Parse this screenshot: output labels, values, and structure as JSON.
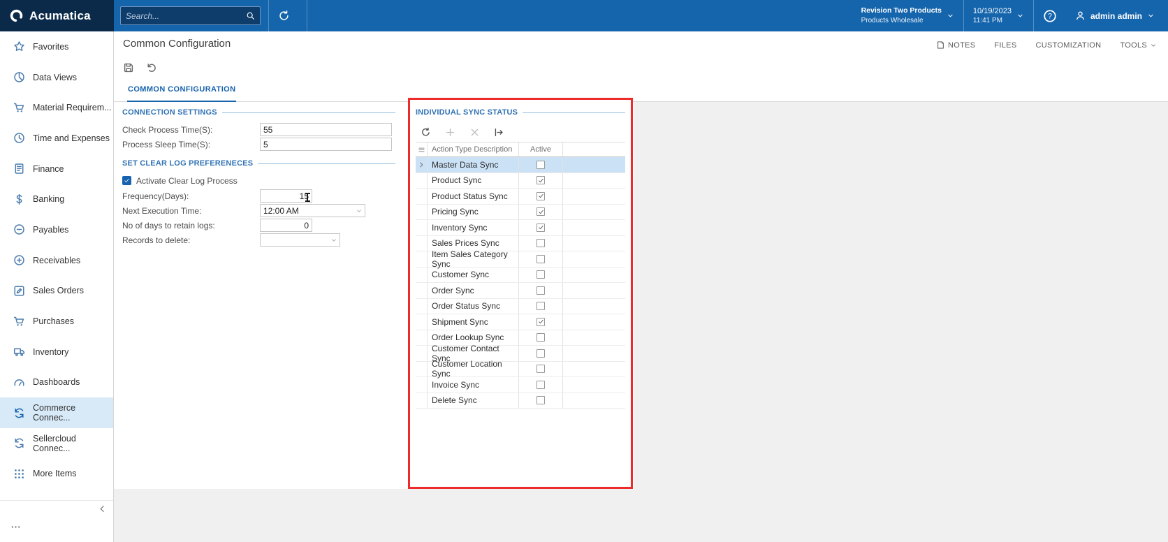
{
  "colors": {
    "topbar": "#1565ad",
    "logo_bg": "#0b2a4a",
    "accent": "#1763ae",
    "annotation": "#ee2b2b",
    "selected_row": "#cbe1f6",
    "sidebar_active_bg": "#d8eaf8"
  },
  "topbar": {
    "brand": "Acumatica",
    "search_placeholder": "Search...",
    "company_line1": "Revision Two Products",
    "company_line2": "Products Wholesale",
    "date": "10/19/2023",
    "time": "11:41 PM",
    "user": "admin admin"
  },
  "sidebar": {
    "items": [
      {
        "label": "Favorites",
        "icon": "star-icon"
      },
      {
        "label": "Data Views",
        "icon": "pie-chart-icon"
      },
      {
        "label": "Material Requirem...",
        "icon": "cart-icon"
      },
      {
        "label": "Time and Expenses",
        "icon": "clock-icon"
      },
      {
        "label": "Finance",
        "icon": "ledger-icon"
      },
      {
        "label": "Banking",
        "icon": "dollar-icon"
      },
      {
        "label": "Payables",
        "icon": "minus-circle-icon"
      },
      {
        "label": "Receivables",
        "icon": "plus-circle-icon"
      },
      {
        "label": "Sales Orders",
        "icon": "pencil-icon"
      },
      {
        "label": "Purchases",
        "icon": "cart-icon"
      },
      {
        "label": "Inventory",
        "icon": "truck-icon"
      },
      {
        "label": "Dashboards",
        "icon": "gauge-icon"
      },
      {
        "label": "Commerce Connec...",
        "icon": "sync-icon",
        "active": true
      },
      {
        "label": "Sellercloud Connec...",
        "icon": "sync-icon"
      },
      {
        "label": "More Items",
        "icon": "grid-dots-icon"
      }
    ]
  },
  "header": {
    "title": "Common Configuration",
    "links": [
      {
        "label": "NOTES",
        "icon": "note-icon"
      },
      {
        "label": "FILES"
      },
      {
        "label": "CUSTOMIZATION"
      },
      {
        "label": "TOOLS",
        "caret": true
      }
    ]
  },
  "tabs": [
    {
      "label": "COMMON CONFIGURATION",
      "active": true
    }
  ],
  "form": {
    "connection": {
      "title": "CONNECTION SETTINGS",
      "fields": [
        {
          "label": "Check Process Time(S):",
          "value": "55",
          "type": "text"
        },
        {
          "label": "Process Sleep Time(S):",
          "value": "5",
          "type": "text"
        }
      ]
    },
    "clear_log": {
      "title": "SET CLEAR LOG PREFERENECES",
      "checkbox_label": "Activate Clear Log Process",
      "checkbox_checked": true,
      "fields": [
        {
          "label": "Frequency(Days):",
          "value": "15",
          "type": "text"
        },
        {
          "label": "Next Execution Time:",
          "value": "12:00 AM",
          "type": "combo"
        },
        {
          "label": "No of days to retain logs:",
          "value": "0",
          "type": "text"
        },
        {
          "label": "Records to delete:",
          "value": "",
          "type": "combo"
        }
      ]
    }
  },
  "sync_panel": {
    "title": "INDIVIDUAL SYNC STATUS",
    "columns": [
      "Action Type Description",
      "Active"
    ],
    "rows": [
      {
        "name": "Master Data Sync",
        "active": false,
        "selected": true
      },
      {
        "name": "Product Sync",
        "active": true
      },
      {
        "name": "Product Status Sync",
        "active": true
      },
      {
        "name": "Pricing Sync",
        "active": true
      },
      {
        "name": "Inventory Sync",
        "active": true
      },
      {
        "name": "Sales Prices Sync",
        "active": false
      },
      {
        "name": "Item Sales Category Sync",
        "active": false
      },
      {
        "name": "Customer Sync",
        "active": false
      },
      {
        "name": "Order Sync",
        "active": false
      },
      {
        "name": "Order Status Sync",
        "active": false
      },
      {
        "name": "Shipment Sync",
        "active": true
      },
      {
        "name": "Order Lookup Sync",
        "active": false
      },
      {
        "name": "Customer Contact Sync",
        "active": false
      },
      {
        "name": "Customer Location Sync",
        "active": false
      },
      {
        "name": "Invoice Sync",
        "active": false
      },
      {
        "name": "Delete Sync",
        "active": false
      }
    ]
  }
}
